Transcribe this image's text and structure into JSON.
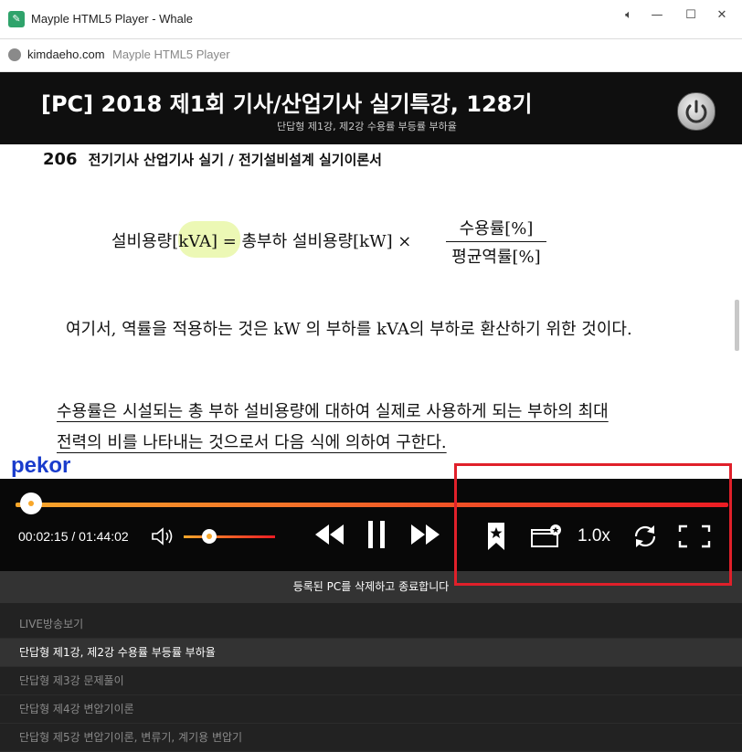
{
  "window": {
    "title": "Mayple HTML5 Player - Whale"
  },
  "address": {
    "domain": "kimdaeho.com",
    "page_title": "Mayple HTML5 Player"
  },
  "header": {
    "title": "[PC] 2018 제1회 기사/산업기사 실기특강, 128기",
    "subtitle": "단답형 제1강, 제2강 수용률 부등률 부하율"
  },
  "document": {
    "page_number": "206",
    "running_head": "전기기사 산업기사 실기 / 전기설비설계 실기이론서",
    "formula_left": "설비용량[kVA] = 총부하 설비용량[kW] ×",
    "formula_numerator": "수용률[%]",
    "formula_denominator": "평균역률[%]",
    "paragraph1": "여기서, 역률을 적용하는 것은 kW 의 부하를 kVA의 부하로 환산하기 위한 것이다.",
    "paragraph2_line1": "수용률은 시설되는 총 부하 설비용량에 대하여 실제로 사용하게 되는 부하의 최대",
    "paragraph2_line2": "전력의 비를 나타내는 것으로서 다음 식에 의하여 구한다."
  },
  "watermark": "pekor",
  "player": {
    "time": "00:02:15 / 01:44:02",
    "progress_fraction": 0.0216,
    "volume_fraction": 0.28,
    "speed": "1.0x",
    "colors": {
      "progress_start": "#f8a72a",
      "progress_end": "#ec1c24"
    }
  },
  "notice": "등록된 PC를 삭제하고 종료합니다",
  "playlist": [
    {
      "label": "LIVE방송보기",
      "active": false
    },
    {
      "label": "단답형 제1강, 제2강 수용률 부등률 부하율",
      "active": true
    },
    {
      "label": "단답형 제3강 문제풀이",
      "active": false
    },
    {
      "label": "단답형 제4강 변압기이론",
      "active": false
    },
    {
      "label": "단답형 제5강 변압기이론, 변류기, 계기용 변압기",
      "active": false
    }
  ],
  "icons": [
    "minimize-icon",
    "maximize-icon",
    "close-icon",
    "power-icon",
    "volume-icon",
    "rewind-icon",
    "pause-icon",
    "fast-forward-icon",
    "bookmark-icon",
    "bookmark-list-icon",
    "repeat-icon",
    "fullscreen-icon"
  ]
}
